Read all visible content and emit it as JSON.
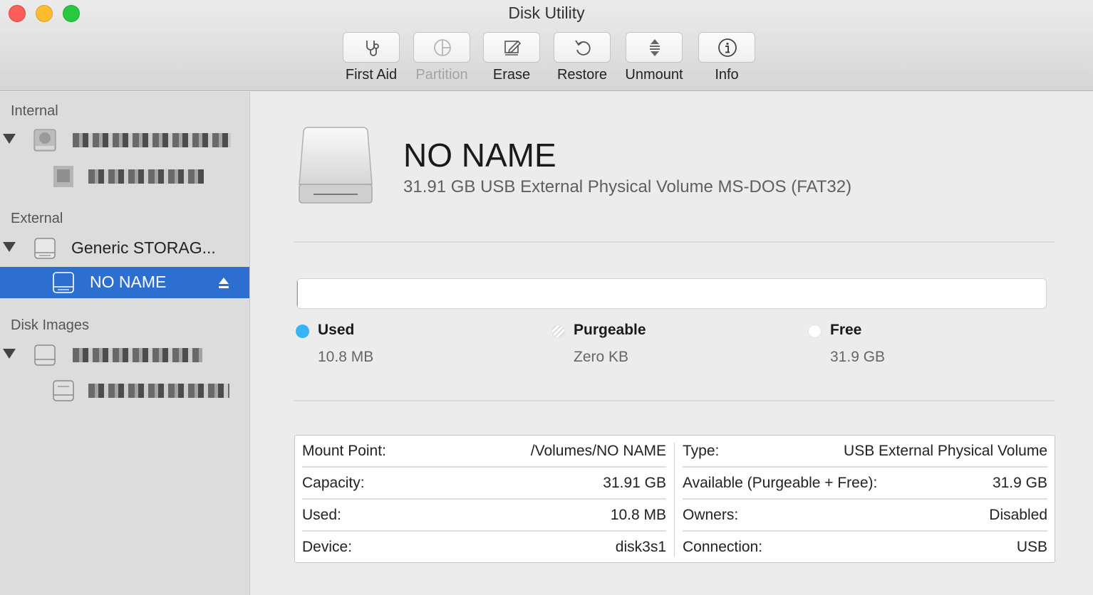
{
  "window": {
    "title": "Disk Utility"
  },
  "toolbar": [
    {
      "label": "First Aid",
      "icon": "stethoscope-icon",
      "enabled": true
    },
    {
      "label": "Partition",
      "icon": "partition-pie-icon",
      "enabled": false
    },
    {
      "label": "Erase",
      "icon": "erase-pencil-icon",
      "enabled": true
    },
    {
      "label": "Restore",
      "icon": "restore-arrow-icon",
      "enabled": true
    },
    {
      "label": "Unmount",
      "icon": "unmount-icon",
      "enabled": true
    },
    {
      "label": "Info",
      "icon": "info-icon",
      "enabled": true
    }
  ],
  "sidebar": {
    "sections": {
      "internal": "Internal",
      "external": "External",
      "disk_images": "Disk Images"
    },
    "external_items": {
      "disk": "Generic STORAG...",
      "volume": "NO NAME"
    },
    "selected": "NO NAME"
  },
  "volume": {
    "name": "NO NAME",
    "description": "31.91 GB USB External Physical Volume MS-DOS (FAT32)"
  },
  "usage": {
    "used_fraction": 0.0003,
    "legend": [
      {
        "title": "Used",
        "value": "10.8 MB",
        "color": "#35b5f5"
      },
      {
        "title": "Purgeable",
        "value": "Zero KB",
        "color": "#ffffff"
      },
      {
        "title": "Free",
        "value": "31.9 GB",
        "color": "#ffffff"
      }
    ]
  },
  "info": {
    "left": [
      {
        "key": "Mount Point:",
        "value": "/Volumes/NO NAME"
      },
      {
        "key": "Capacity:",
        "value": "31.91 GB"
      },
      {
        "key": "Used:",
        "value": "10.8 MB"
      },
      {
        "key": "Device:",
        "value": "disk3s1"
      }
    ],
    "right": [
      {
        "key": "Type:",
        "value": "USB External Physical Volume"
      },
      {
        "key": "Available (Purgeable + Free):",
        "value": "31.9 GB"
      },
      {
        "key": "Owners:",
        "value": "Disabled"
      },
      {
        "key": "Connection:",
        "value": "USB"
      }
    ]
  },
  "colors": {
    "accent": "#2c6fd0",
    "used": "#35b5f5"
  }
}
